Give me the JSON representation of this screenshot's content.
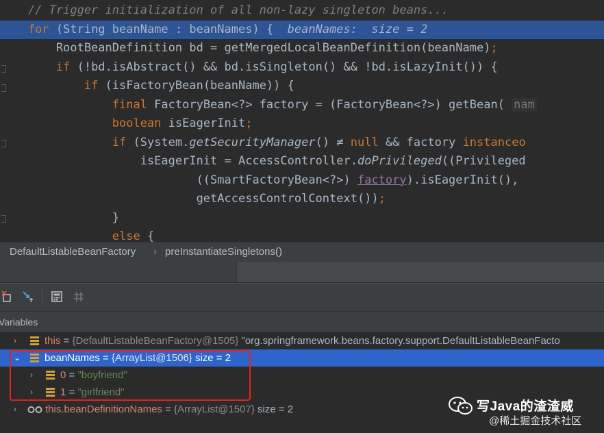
{
  "editor": {
    "lines": [
      {
        "parts": [
          [
            "c",
            "    // Trigger initialization of all non-lazy singleton beans..."
          ]
        ]
      },
      {
        "exec": true,
        "parts": [
          [
            "k",
            "    for "
          ],
          [
            "n",
            "(String beanName : beanNames) {  "
          ],
          [
            "v",
            "beanNames:  size = 2"
          ]
        ]
      },
      {
        "parts": [
          [
            "n",
            "        RootBeanDefinition bd = getMergedLocalBeanDefinition(beanName)"
          ],
          [
            "k",
            ";"
          ]
        ]
      },
      {
        "parts": [
          [
            "k",
            "        if "
          ],
          [
            "n",
            "(!bd.isAbstract() && bd.isSingleton() && !bd.isLazyInit()) {"
          ]
        ]
      },
      {
        "parts": [
          [
            "k",
            "            if "
          ],
          [
            "n",
            "(isFactoryBean(beanName)) {"
          ]
        ]
      },
      {
        "parts": [
          [
            "k",
            "                final "
          ],
          [
            "n",
            "FactoryBean<?> factory = (FactoryBean<?>) getBean( "
          ],
          [
            "h",
            "nam"
          ]
        ]
      },
      {
        "parts": [
          [
            "k",
            "                boolean "
          ],
          [
            "n",
            "isEagerInit"
          ],
          [
            "k",
            ";"
          ]
        ]
      },
      {
        "parts": [
          [
            "k",
            "                if "
          ],
          [
            "n",
            "(System."
          ],
          [
            "i",
            "getSecurityManager"
          ],
          [
            "n",
            "() ≠ "
          ],
          [
            "k",
            "null "
          ],
          [
            "n",
            "&& factory "
          ],
          [
            "k",
            "instanceo"
          ]
        ]
      },
      {
        "parts": [
          [
            "n",
            "                    isEagerInit = AccessController."
          ],
          [
            "i",
            "doPrivileged"
          ],
          [
            "n",
            "((Privileged"
          ]
        ]
      },
      {
        "parts": [
          [
            "n",
            "                            ((SmartFactoryBean<?>) "
          ],
          [
            "r",
            "factory"
          ],
          [
            "n",
            ").isEagerInit(),"
          ]
        ]
      },
      {
        "parts": [
          [
            "n",
            "                            getAccessControlContext())"
          ],
          [
            "k",
            ";"
          ]
        ]
      },
      {
        "parts": [
          [
            "n",
            "                }"
          ]
        ]
      },
      {
        "parts": [
          [
            "k",
            "                else "
          ],
          [
            "n",
            "{"
          ]
        ]
      }
    ]
  },
  "breadcrumb": {
    "class_name": "DefaultListableBeanFactory",
    "separator": "›",
    "method_name": "preInstantiateSingletons()"
  },
  "debug": {
    "variables_title": "Variables",
    "toolbar_icons": [
      "restore-breakpoint-icon",
      "evaluate-cursor-icon",
      "calculator-icon",
      "grid-icon"
    ]
  },
  "variables": [
    {
      "name": "this",
      "eq": " = ",
      "type": "{DefaultListableBeanFactory@1505}",
      "value": " \"org.springframework.beans.factory.support.DefaultListableBeanFacto"
    },
    {
      "name": "beanNames",
      "eq": " = ",
      "type": "{ArrayList@1506}",
      "value": "  size = 2"
    },
    {
      "name": "0",
      "eq": " = ",
      "value": "\"boyfriend\""
    },
    {
      "name": "1",
      "eq": " = ",
      "value": "\"girlfriend\""
    },
    {
      "name": "this.beanDefinitionNames",
      "eq": " = ",
      "type": "{ArrayList@1507}",
      "value": "  size = 2"
    }
  ],
  "watermark": {
    "title": "写Java的渣渣威",
    "subtitle": "@稀土掘金技术社区"
  },
  "colors": {
    "highlight_box": "#e0251e",
    "selection": "#2f65ca",
    "exec_line": "#2d5494"
  }
}
